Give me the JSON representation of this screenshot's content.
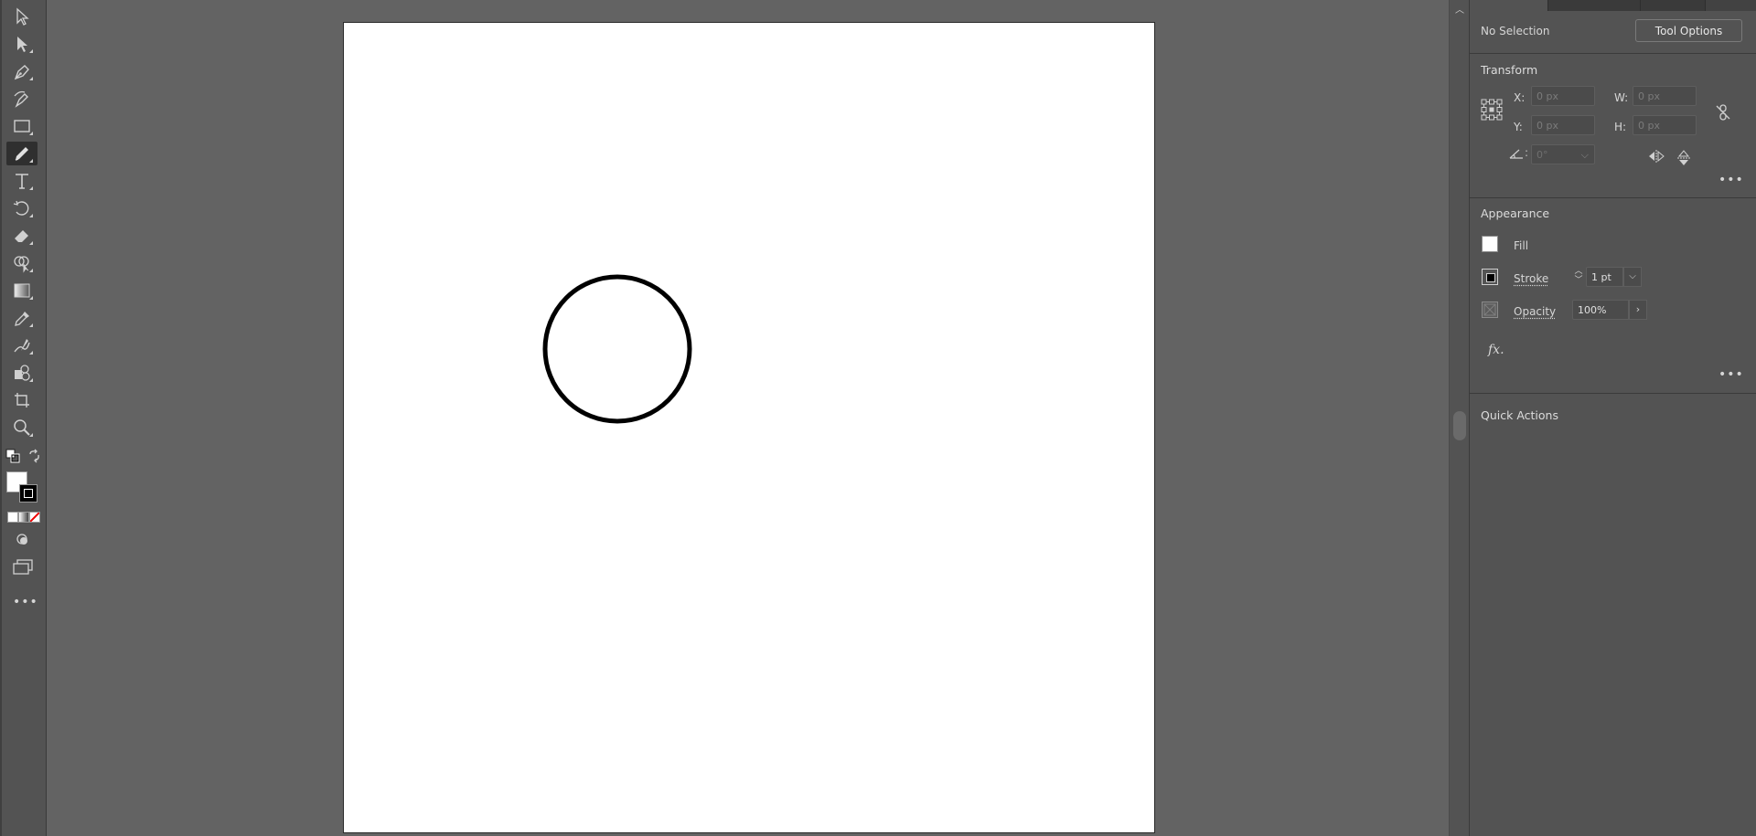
{
  "toolbar": {
    "tools": [
      {
        "name": "selection-tool-icon"
      },
      {
        "name": "direct-selection-tool-icon"
      },
      {
        "name": "pen-tool-icon"
      },
      {
        "name": "curvature-tool-icon"
      },
      {
        "name": "rectangle-tool-icon"
      },
      {
        "name": "pencil-tool-icon",
        "active": true
      },
      {
        "name": "type-tool-icon"
      },
      {
        "name": "rotate-tool-icon"
      },
      {
        "name": "eraser-tool-icon"
      },
      {
        "name": "shape-builder-tool-icon"
      },
      {
        "name": "gradient-tool-icon"
      },
      {
        "name": "eyedropper-tool-icon"
      },
      {
        "name": "puppet-warp-tool-icon"
      },
      {
        "name": "symbol-sprayer-tool-icon"
      },
      {
        "name": "artboard-tool-icon"
      },
      {
        "name": "zoom-tool-icon"
      }
    ],
    "more_label": "•••",
    "fill_color": "#ffffff",
    "stroke_color": "#000000"
  },
  "canvas": {
    "artboard_color": "#ffffff",
    "shape": "circle",
    "shape_stroke": "#000000"
  },
  "panel": {
    "selection_status": "No Selection",
    "tool_options_label": "Tool Options",
    "transform": {
      "title": "Transform",
      "x_label": "X:",
      "x_value": "0 px",
      "y_label": "Y:",
      "y_value": "0 px",
      "w_label": "W:",
      "w_value": "0 px",
      "h_label": "H:",
      "h_value": "0 px",
      "angle_value": "0°"
    },
    "appearance": {
      "title": "Appearance",
      "fill_label": "Fill",
      "stroke_label": "Stroke",
      "stroke_value": "1 pt",
      "opacity_label": "Opacity",
      "opacity_value": "100%",
      "fx_label": "fx."
    },
    "quick_actions_title": "Quick Actions",
    "more_label": "•••"
  }
}
